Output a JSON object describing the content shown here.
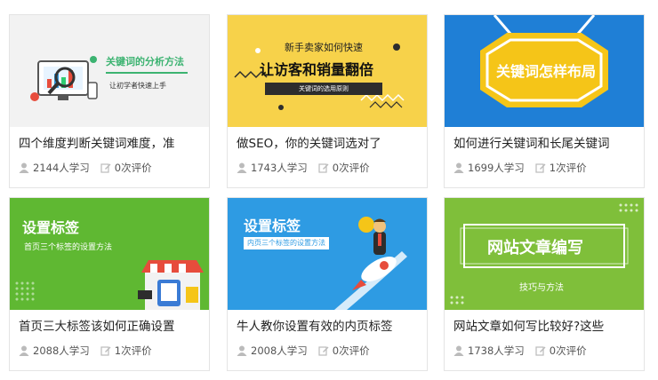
{
  "courses": [
    {
      "thumb": {
        "headline": "关键词的分析方法",
        "sub": "让初学者快速上手"
      },
      "title": "四个维度判断关键词难度，准",
      "students": "2144人学习",
      "reviews": "0次评价"
    },
    {
      "thumb": {
        "top": "新手卖家如何快速",
        "headline": "让访客和销量翻倍",
        "sub": "关键词的选用原则"
      },
      "title": "做SEO，你的关键词选对了",
      "students": "1743人学习",
      "reviews": "0次评价"
    },
    {
      "thumb": {
        "headline": "关键词怎样布局"
      },
      "title": "如何进行关键词和长尾关键词",
      "students": "1699人学习",
      "reviews": "1次评价"
    },
    {
      "thumb": {
        "headline": "设置标签",
        "sub": "首页三个标签的设置方法"
      },
      "title": "首页三大标签该如何正确设置",
      "students": "2088人学习",
      "reviews": "1次评价"
    },
    {
      "thumb": {
        "headline": "设置标签",
        "sub": "内页三个标签的设置方法"
      },
      "title": "牛人教你设置有效的内页标签",
      "students": "2008人学习",
      "reviews": "0次评价"
    },
    {
      "thumb": {
        "headline": "网站文章编写",
        "sub": "技巧与方法"
      },
      "title": "网站文章如何写比较好?这些",
      "students": "1738人学习",
      "reviews": "0次评价"
    }
  ],
  "colors": {
    "card1_bg": "#f2f2f2",
    "card1_accent": "#3cb371",
    "card2_bg": "#f7d24a",
    "card3_bg": "#1f7fd6",
    "card3_sign": "#f5c518",
    "card4_bg": "#5fb832",
    "card5_bg": "#2e9be3",
    "card6_bg": "#7fbf3a"
  },
  "icons": {
    "students": "person-icon",
    "reviews": "edit-icon"
  }
}
